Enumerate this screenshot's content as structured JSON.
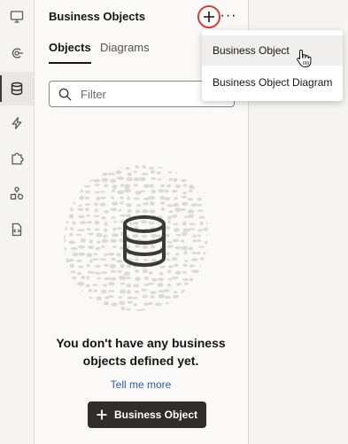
{
  "panel": {
    "title": "Business Objects",
    "more_label": "···",
    "tabs": [
      {
        "label": "Objects",
        "active": true
      },
      {
        "label": "Diagrams",
        "active": false
      }
    ],
    "filter": {
      "placeholder": "Filter",
      "value": ""
    }
  },
  "empty_state": {
    "line1": "You don't have any business",
    "line2": "objects defined yet.",
    "link": "Tell me more",
    "button_label": "Business Object"
  },
  "menu": {
    "items": [
      {
        "label": "Business Object",
        "hovered": true
      },
      {
        "label": "Business Object Diagram",
        "hovered": false
      }
    ]
  },
  "rail": {
    "items": [
      "desktop-icon",
      "service-connections-icon",
      "database-icon",
      "events-icon",
      "components-icon",
      "processes-icon",
      "source-file-icon"
    ],
    "active_index": 2
  },
  "colors": {
    "accent_ring": "#d63b3b",
    "primary_button": "#312d2a",
    "link": "#315f99"
  }
}
